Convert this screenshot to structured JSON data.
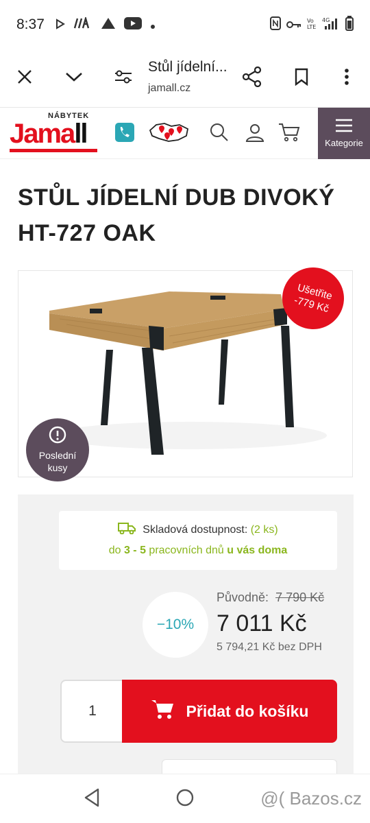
{
  "status_bar": {
    "time": "8:37",
    "icons_left": [
      "play-icon",
      "app-icon",
      "triangle-icon",
      "youtube-icon",
      "dot-icon"
    ],
    "icons_right": [
      "nfc-icon",
      "key-icon",
      "volte-icon",
      "4g-signal-icon",
      "battery-icon"
    ]
  },
  "browser": {
    "title": "Stůl jídelní...",
    "url": "jamall.cz"
  },
  "site_header": {
    "logo_small": "NÁBYTEK",
    "logo_main_red": "Jama",
    "logo_main_black": "ll",
    "kategorie_label": "Kategorie"
  },
  "product": {
    "title": "STŮL JÍDELNÍ DUB DIVOKÝ HT-727 OAK",
    "save_badge_line1": "Ušetřite",
    "save_badge_line2": "-779 Kč",
    "last_badge_line1": "Poslední",
    "last_badge_line2": "kusy"
  },
  "stock": {
    "label": "Skladová dostupnost:",
    "count": "(2 ks)",
    "delivery_prefix": "do ",
    "delivery_range": "3 - 5",
    "delivery_mid": " pracovních dnů ",
    "delivery_suffix": "u vás doma"
  },
  "price": {
    "discount": "−10%",
    "original_label": "Původně:",
    "original_value": "7 790 Kč",
    "current": "7 011 Kč",
    "net": "5 794,21 Kč bez DPH"
  },
  "cart": {
    "quantity": "1",
    "button_label": "Přidat do košíku"
  },
  "watermark": "@(  Bazos.cz",
  "colors": {
    "brand_red": "#e3101e",
    "kategorie_bg": "#5c4c5c",
    "stock_green": "#8ab61d",
    "discount_teal": "#2ba7b5"
  }
}
